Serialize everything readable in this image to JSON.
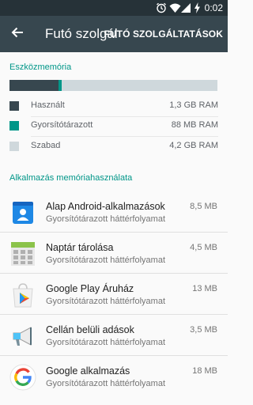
{
  "status_bar": {
    "time": "0:02",
    "icons": [
      "alarm-icon",
      "wifi-icon",
      "signal-icon",
      "battery-charging-icon"
    ]
  },
  "app_bar": {
    "title": "Futó szolgáltatások",
    "action_label": "FUTÓ SZOLGÁLTATÁSOK",
    "back_icon": "arrow-left-icon"
  },
  "device_memory": {
    "header": "Eszközmemória",
    "usage_fractions": {
      "used": 0.235,
      "cached": 0.016,
      "free": 0.749
    },
    "colors": {
      "used": "#37474f",
      "cached": "#009688",
      "free": "#cfd8dc"
    },
    "legend": [
      {
        "label": "Használt",
        "value": "1,3 GB RAM"
      },
      {
        "label": "Gyorsítótárazott",
        "value": "88 MB RAM"
      },
      {
        "label": "Szabad",
        "value": "4,2 GB RAM"
      }
    ]
  },
  "app_memory": {
    "header": "Alkalmazás memóriahasználata",
    "items": [
      {
        "name": "Alap Android-alkalmazások",
        "status": "Gyorsítótárazott háttérfolyamat",
        "size": "8,5 MB",
        "icon": "android-contacts-icon"
      },
      {
        "name": "Naptár tárolása",
        "status": "Gyorsítótárazott háttérfolyamat",
        "size": "4,5 MB",
        "icon": "calendar-storage-icon"
      },
      {
        "name": "Google Play Áruház",
        "status": "Gyorsítótárazott háttérfolyamat",
        "size": "13 MB",
        "icon": "google-play-icon"
      },
      {
        "name": "Cellán belüli adások",
        "status": "Gyorsítótárazott háttérfolyamat",
        "size": "3,5 MB",
        "icon": "megaphone-icon"
      },
      {
        "name": "Google alkalmazás",
        "status": "Gyorsítótárazott háttérfolyamat",
        "size": "18 MB",
        "icon": "google-g-icon"
      }
    ]
  },
  "accent_color": "#009688"
}
